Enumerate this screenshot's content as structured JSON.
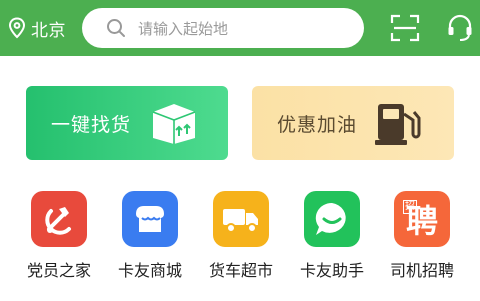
{
  "header": {
    "city": "北京",
    "search": {
      "placeholder": "请输入起始地"
    }
  },
  "cards": [
    {
      "label": "一键找货",
      "icon": "box-upload-icon"
    },
    {
      "label": "优惠加油",
      "icon": "fuel-pump-icon"
    }
  ],
  "apps": [
    {
      "label": "党员之家",
      "icon": "party-emblem-icon",
      "color": "#e84a3c"
    },
    {
      "label": "卡友商城",
      "icon": "shop-icon",
      "color": "#3a7cf0"
    },
    {
      "label": "货车超市",
      "icon": "truck-icon",
      "color": "#f6b21b"
    },
    {
      "label": "卡友助手",
      "icon": "chat-bubble-icon",
      "color": "#22c25b"
    },
    {
      "label": "司机招聘",
      "icon": "recruit-icon",
      "icon_text": "聘",
      "icon_subtext": "招",
      "color": "#f5673a"
    }
  ],
  "colors": {
    "header": "#4caf50",
    "find_card": "#25c06e",
    "fuel_card": "#fbe1a5"
  }
}
